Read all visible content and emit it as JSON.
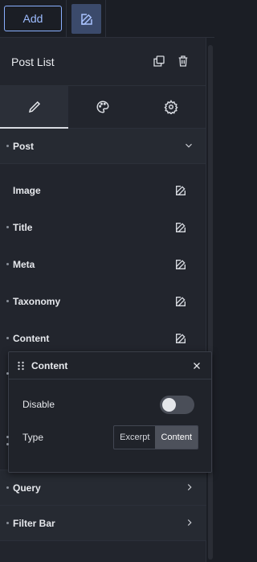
{
  "topbar": {
    "add_label": "Add"
  },
  "panel": {
    "title": "Post List"
  },
  "tabs": [
    {
      "name": "content",
      "icon": "pencil-icon"
    },
    {
      "name": "style",
      "icon": "palette-icon"
    },
    {
      "name": "advanced",
      "icon": "gear-icon"
    }
  ],
  "sections": {
    "post": "Post",
    "query": "Query",
    "filter_bar": "Filter Bar"
  },
  "items": [
    "Image",
    "Title",
    "Meta",
    "Taxonomy",
    "Content"
  ],
  "popup": {
    "title": "Content",
    "disable_label": "Disable",
    "type_label": "Type",
    "options": [
      "Excerpt",
      "Content"
    ],
    "selected": "Content"
  },
  "colors": {
    "accent": "#8ab0ff",
    "panel": "#22252d",
    "background": "#1b1e25"
  }
}
